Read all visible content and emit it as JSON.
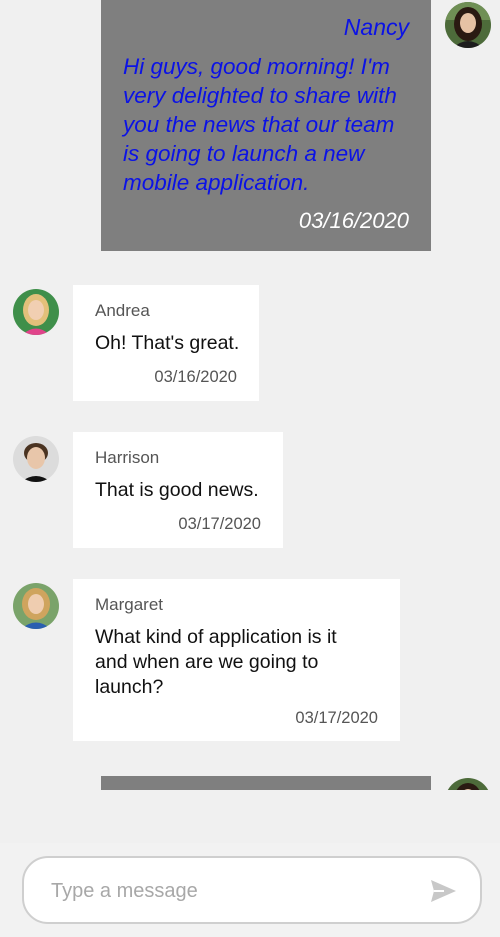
{
  "messages": [
    {
      "sender": "Nancy",
      "text": "Hi guys, good morning! I'm very delighted to share with you the news that our team is going to launch a new mobile application.",
      "date": "03/16/2020",
      "direction": "outgoing"
    },
    {
      "sender": "Andrea",
      "text": "Oh! That's great.",
      "date": "03/16/2020",
      "direction": "incoming"
    },
    {
      "sender": "Harrison",
      "text": "That is good news.",
      "date": "03/17/2020",
      "direction": "incoming"
    },
    {
      "sender": "Margaret",
      "text": "What kind of application is it and when are we going to launch?",
      "date": "03/17/2020",
      "direction": "incoming"
    }
  ],
  "composer": {
    "placeholder": "Type a message",
    "value": "",
    "send_icon": "send-icon"
  },
  "colors": {
    "background": "#f0f0f0",
    "outgoing_bubble": "#7f7f7f",
    "outgoing_text": "#0b12e6",
    "outgoing_date": "#ffffff",
    "incoming_bubble": "#ffffff",
    "send_icon": "#c8c8c8"
  }
}
